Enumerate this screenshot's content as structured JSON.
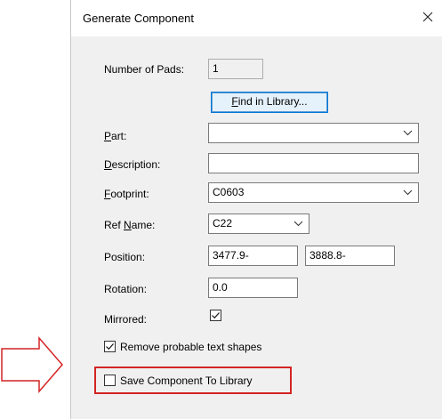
{
  "window": {
    "title": "Generate Component",
    "close_icon": "close-icon"
  },
  "form": {
    "pads_label": "Number of Pads:",
    "pads_value": "1",
    "find_button": {
      "mnemonic": "F",
      "rest": "ind in Library..."
    },
    "part_label": {
      "mnemonic": "P",
      "rest": "art:"
    },
    "part_value": "",
    "description_label": {
      "mnemonic": "D",
      "rest": "escription:"
    },
    "description_value": "",
    "footprint_label": {
      "mnemonic": "F",
      "rest": "ootprint:"
    },
    "footprint_value": "C0603",
    "refname_label": {
      "prefix": "Ref ",
      "mnemonic": "N",
      "rest": "ame:"
    },
    "refname_value": "C22",
    "position_label": "Position:",
    "position_x": "3477.9-",
    "position_y": "3888.8-",
    "rotation_label": "Rotation:",
    "rotation_value": "0.0",
    "mirrored_label": "Mirrored:",
    "mirrored_checked": true,
    "remove_shapes_label": "Remove probable text shapes",
    "remove_shapes_checked": true,
    "save_library_label": "Save Component To Library",
    "save_library_checked": false
  },
  "colors": {
    "accent": "#0078d7",
    "highlight": "#d42424"
  }
}
